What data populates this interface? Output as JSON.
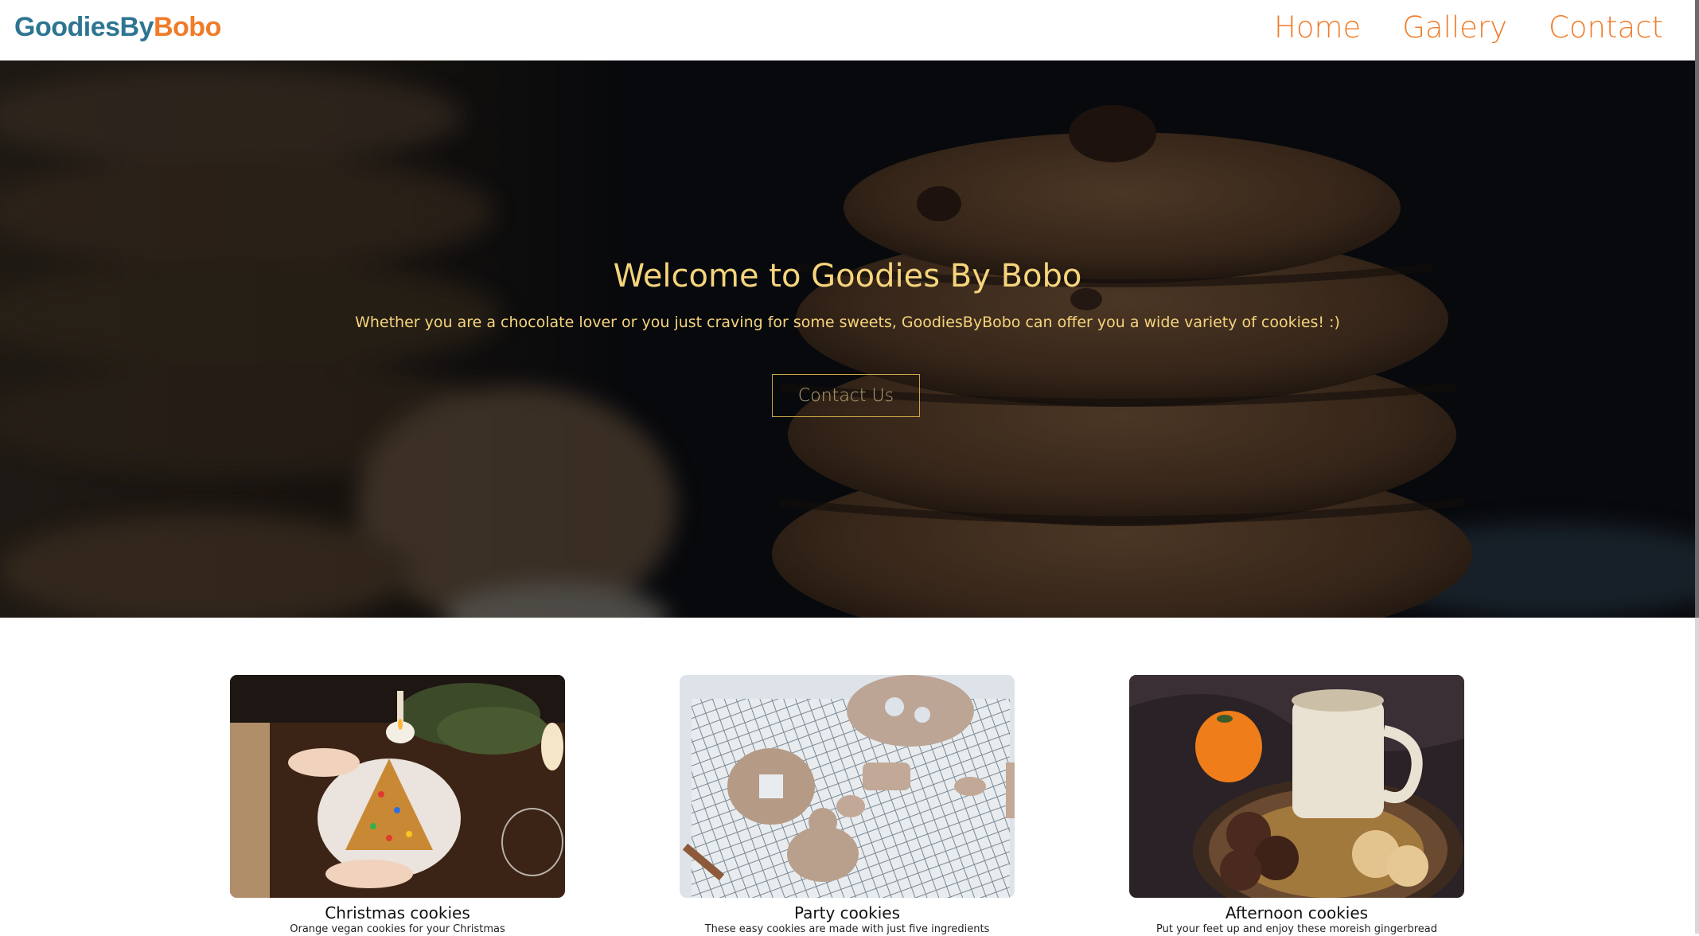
{
  "navbar": {
    "brand_part1": "GoodiesBy",
    "brand_part2": "Bobo",
    "links": [
      {
        "label": "Home"
      },
      {
        "label": "Gallery"
      },
      {
        "label": "Contact"
      }
    ]
  },
  "hero": {
    "title": "Welcome to Goodies By Bobo",
    "subtitle": "Whether you are a chocolate lover or you just craving for some sweets, GoodiesByBobo can offer you a wide variety of cookies! :)",
    "button_label": "Contact Us"
  },
  "cards": [
    {
      "title": "Christmas cookies",
      "description": "Orange vegan cookies for your Christmas"
    },
    {
      "title": "Party cookies",
      "description": "These easy cookies are made with just five ingredients"
    },
    {
      "title": "Afternoon cookies",
      "description": "Put your feet up and enjoy these moreish gingerbread"
    }
  ],
  "colors": {
    "brand_blue": "#2e7591",
    "brand_orange": "#f07c2a",
    "hero_text": "#f6d47c"
  }
}
